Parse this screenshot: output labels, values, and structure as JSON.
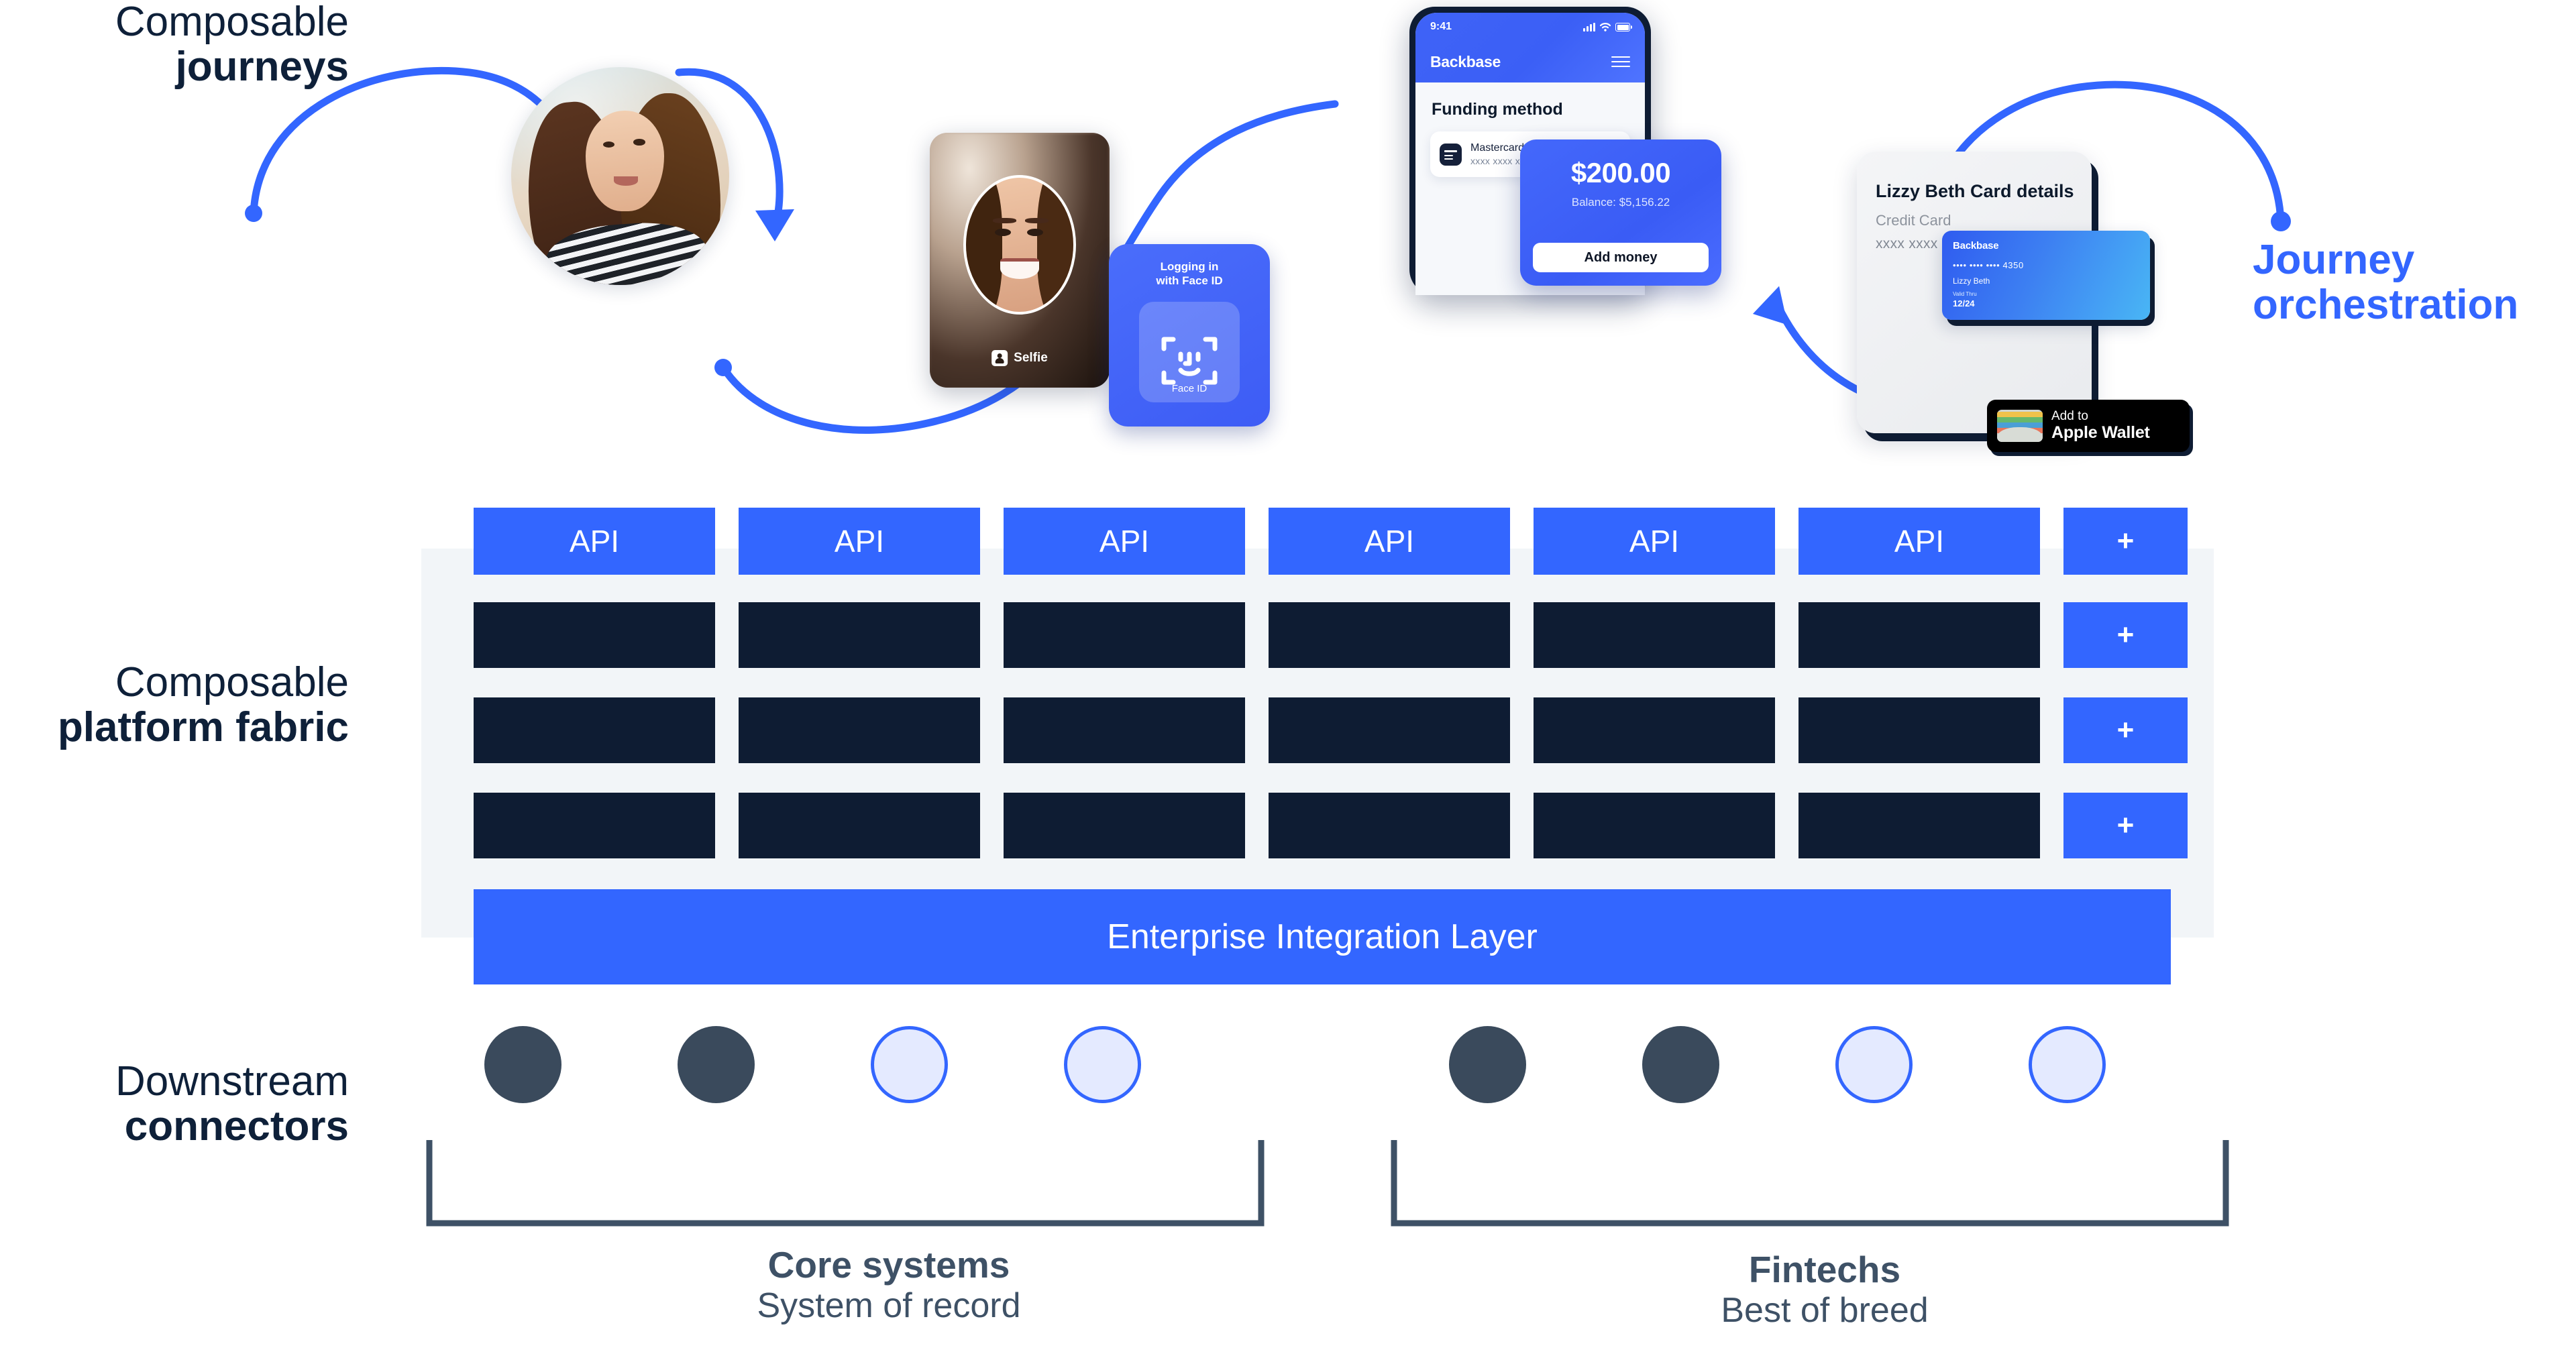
{
  "labels": {
    "journeys": {
      "line1": "Composable",
      "line2": "journeys"
    },
    "fabric": {
      "line1": "Composable",
      "line2": "platform fabric"
    },
    "connectors": {
      "line1": "Downstream",
      "line2": "connectors"
    },
    "orchestration": {
      "line1": "Journey",
      "line2": "orchestration"
    }
  },
  "selfie_card": {
    "tag": "Selfie"
  },
  "faceid_panel": {
    "title_line1": "Logging in",
    "title_line2": "with Face ID",
    "caption": "Face ID"
  },
  "phone": {
    "time": "9:41",
    "brand": "Backbase",
    "section_title": "Funding method",
    "method_name": "Mastercard",
    "method_number": "xxxx xxxx xxxx 4350"
  },
  "money_card": {
    "amount": "$200.00",
    "balance": "Balance: $5,156.22",
    "button": "Add money"
  },
  "card_details": {
    "title": "Lizzy Beth Card details",
    "type": "Credit Card",
    "number": "xxxx xxxx xxxx 4350"
  },
  "credit_card": {
    "brand": "Backbase",
    "number": "•••• •••• •••• 4350",
    "holder": "Lizzy Beth",
    "valid_label": "Valid Thru",
    "valid_value": "12/24"
  },
  "apple_wallet": {
    "line1": "Add to",
    "line2": "Apple Wallet"
  },
  "fabric": {
    "api_label": "API",
    "plus_label": "+",
    "api_count": 6,
    "plus_count": 4,
    "dark_rows": 3,
    "integration_layer": "Enterprise Integration Layer"
  },
  "connectors": {
    "left_group": [
      "dark",
      "dark",
      "light",
      "light"
    ],
    "right_group": [
      "dark",
      "dark",
      "light",
      "light"
    ]
  },
  "bottom": {
    "core": {
      "title": "Core systems",
      "subtitle": "System of record"
    },
    "fintech": {
      "title": "Fintechs",
      "subtitle": "Best of breed"
    }
  },
  "colors": {
    "brand_blue": "#3366ff",
    "navy": "#0e1c33",
    "slate": "#3e5166",
    "panel_gray": "#f2f5f8",
    "connector_light": "#e4eaff"
  }
}
